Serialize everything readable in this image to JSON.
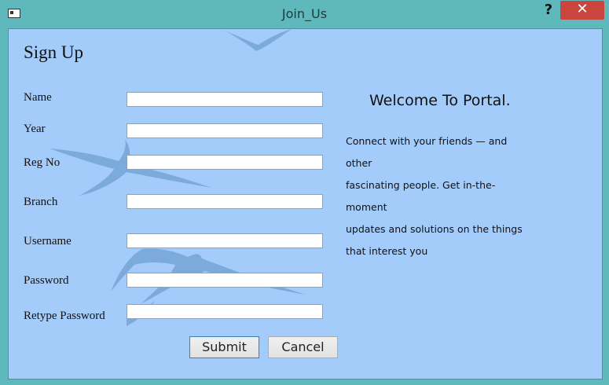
{
  "window": {
    "title": "Join_Us",
    "help_glyph": "?",
    "close_glyph": "✕"
  },
  "form": {
    "heading": "Sign Up",
    "fields": [
      {
        "label": "Name",
        "value": ""
      },
      {
        "label": "Year",
        "value": ""
      },
      {
        "label": "Reg No",
        "value": ""
      },
      {
        "label": "Branch",
        "value": ""
      },
      {
        "label": "Username",
        "value": ""
      },
      {
        "label": "Password",
        "value": ""
      },
      {
        "label": "Retype Password",
        "value": ""
      }
    ],
    "submit_label": "Submit",
    "cancel_label": "Cancel"
  },
  "welcome": {
    "title": "Welcome To Portal.",
    "lines": [
      "Connect with your friends — and other",
      "fascinating people. Get in-the-moment",
      "updates and solutions on the things",
      "that interest you"
    ]
  },
  "colors": {
    "background": "#a4ccfb",
    "frame": "#5fb8bc",
    "close_button": "#c9453e",
    "bird_art": "#6f9fcf"
  }
}
